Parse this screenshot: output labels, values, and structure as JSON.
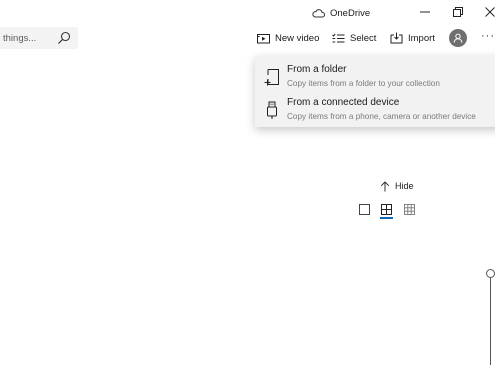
{
  "titlebar": {
    "title": "OneDrive",
    "minimize_glyph": "—",
    "restore_glyph": "❐",
    "close_glyph": "✕"
  },
  "search": {
    "placeholder": "things..."
  },
  "toolbar": {
    "new_video": "New video",
    "select": "Select",
    "import": "Import",
    "more": "···"
  },
  "import_menu": {
    "items": [
      {
        "title": "From a folder",
        "description": "Copy items from a folder to your collection",
        "icon": "folder-import-icon"
      },
      {
        "title": "From a connected device",
        "description": "Copy items from a phone, camera or another device",
        "icon": "usb-device-icon"
      }
    ]
  },
  "view_panel": {
    "hide_label": "Hide",
    "selected_view": "medium-grid"
  },
  "colors": {
    "accent": "#0f6cbd",
    "menu_background": "#f2f2f2",
    "avatar": "#707070"
  }
}
